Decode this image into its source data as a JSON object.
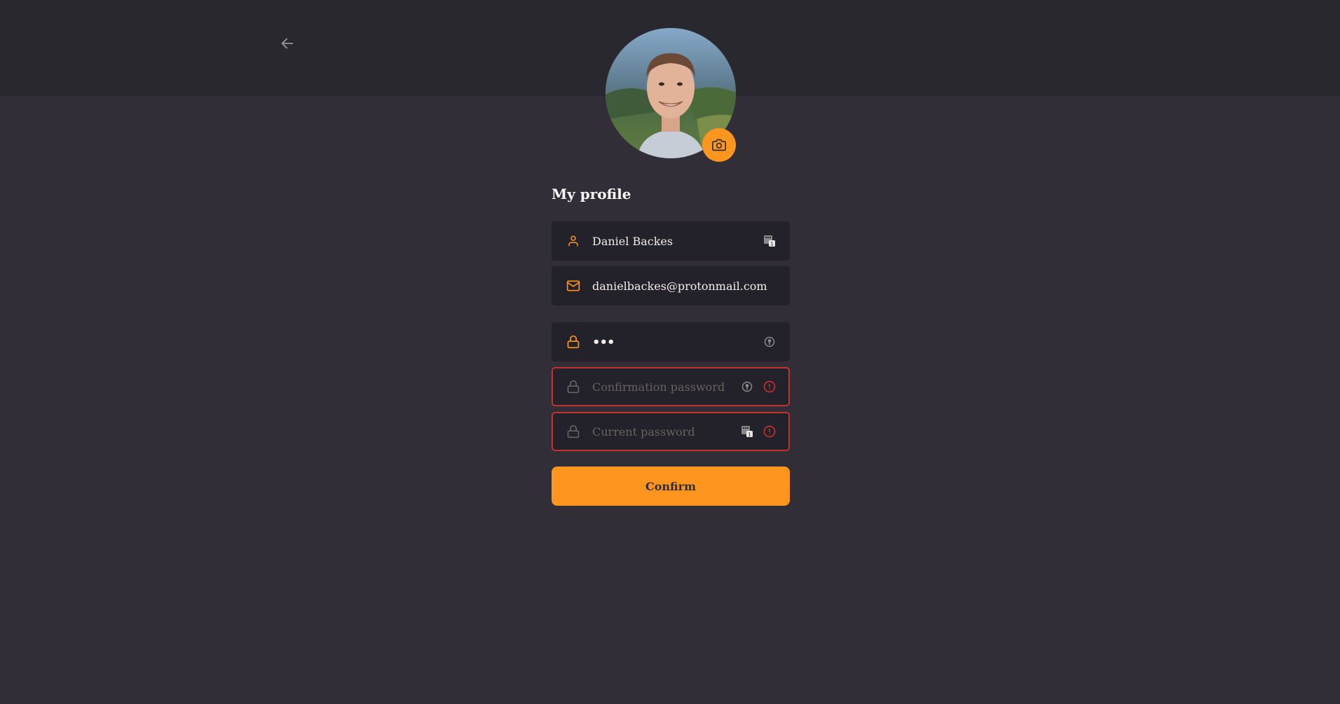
{
  "header": {
    "back_icon": "arrow-left-icon"
  },
  "profile": {
    "avatar_alt": "Daniel Backes",
    "camera_icon": "camera-icon",
    "title": "My profile"
  },
  "fields": {
    "name": {
      "value": "Daniel Backes",
      "icon": "user-icon",
      "trailing_icon": "keypad-badge-icon"
    },
    "email": {
      "value": "danielbackes@protonmail.com",
      "icon": "mail-icon"
    },
    "new_password": {
      "value": "•••",
      "icon": "lock-icon",
      "trailing_icon": "key-badge-icon"
    },
    "confirmation_password": {
      "placeholder": "Confirmation password",
      "value": "",
      "icon": "lock-icon",
      "trailing_icon": "key-badge-icon",
      "error_icon": "alert-circle-icon"
    },
    "current_password": {
      "placeholder": "Current password",
      "value": "",
      "icon": "lock-icon",
      "trailing_icon": "keypad-badge-icon",
      "error_icon": "alert-circle-icon"
    }
  },
  "actions": {
    "confirm_label": "Confirm"
  },
  "colors": {
    "background": "#312e37",
    "header_band": "#29282f",
    "field_bg": "#232129",
    "accent": "#fd951f",
    "error": "#c53030",
    "placeholder": "#666360"
  }
}
